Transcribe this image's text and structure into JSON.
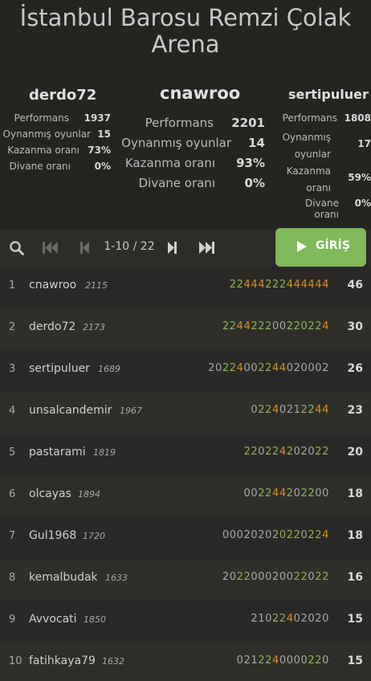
{
  "title_line1": "İstanbul Barosu Remzi Çolak",
  "title_line2": "Arena",
  "podium": [
    {
      "name": "derdo72",
      "stats": [
        {
          "label": "Performans",
          "value": "1937"
        },
        {
          "label": "Oynanmış oyunlar",
          "value": "15"
        },
        {
          "label": "Kazanma oranı",
          "value": "73%"
        },
        {
          "label": "Divane oranı",
          "value": "0%"
        }
      ]
    },
    {
      "name": "cnawroo",
      "stats": [
        {
          "label": "Performans",
          "value": "2201"
        },
        {
          "label": "Oynanmış oyunlar",
          "value": "14"
        },
        {
          "label": "Kazanma oranı",
          "value": "93%"
        },
        {
          "label": "Divane oranı",
          "value": "0%"
        }
      ]
    },
    {
      "name": "sertipuluer",
      "stats": [
        {
          "label": "Performans",
          "value": "1808"
        },
        {
          "label": "Oynanmış oyunlar",
          "value": "17"
        },
        {
          "label": "Kazanma oranı",
          "value": "59%"
        },
        {
          "label": "Divane oranı",
          "value": "0%"
        }
      ]
    }
  ],
  "controls": {
    "search_icon": "search-icon",
    "first_icon": "first-page-icon",
    "prev_icon": "prev-page-icon",
    "page_info": "1-10 / 22",
    "next_icon": "next-page-icon",
    "last_icon": "last-page-icon",
    "join_label": "GİRİŞ",
    "join_icon": "play-icon"
  },
  "colors": {
    "background": "#262421",
    "join_button": "#7fb95a",
    "streak_green": "#8bb554",
    "streak_orange": "#d59120"
  },
  "standings": [
    {
      "rank": "1",
      "name": "cnawroo",
      "rating": "2115",
      "sheet": "22444222444444",
      "score": "46"
    },
    {
      "rank": "2",
      "name": "derdo72",
      "rating": "2173",
      "sheet": "22442220022022 4",
      "score": "30"
    },
    {
      "rank": "3",
      "name": "sertipuluer",
      "rating": "1689",
      "sheet": "20224002244020002",
      "score": "26"
    },
    {
      "rank": "4",
      "name": "unsalcandemir",
      "rating": "1967",
      "sheet": "0224021224 4",
      "score": "23"
    },
    {
      "rank": "5",
      "name": "pastarami",
      "rating": "1819",
      "sheet": "220224202022",
      "score": "20"
    },
    {
      "rank": "6",
      "name": "olcayas",
      "rating": "1894",
      "sheet": "0022442022 00",
      "score": "18"
    },
    {
      "rank": "7",
      "name": "Gul1968",
      "rating": "1720",
      "sheet": "00020202022022 4",
      "score": "18"
    },
    {
      "rank": "8",
      "name": "kemalbudak",
      "rating": "1633",
      "sheet": "2022000200 22022",
      "score": "16"
    },
    {
      "rank": "9",
      "name": "Avvocati",
      "rating": "1850",
      "sheet": "2102240 2020",
      "score": "15"
    },
    {
      "rank": "10",
      "name": "fatihkaya79",
      "rating": "1632",
      "sheet": "0212240000220",
      "score": "15"
    }
  ]
}
